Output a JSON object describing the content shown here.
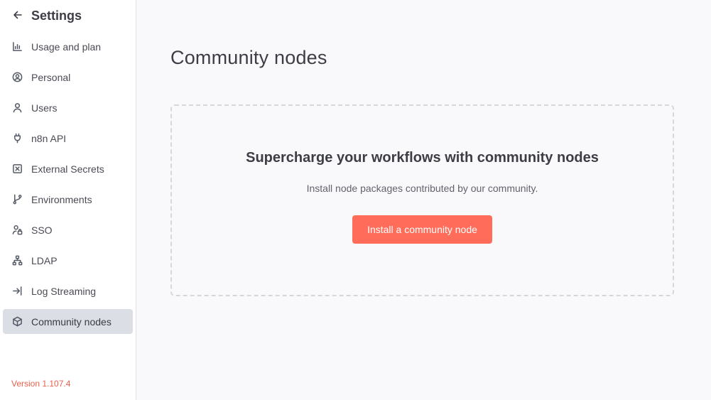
{
  "sidebar": {
    "title": "Settings",
    "items": [
      {
        "label": "Usage and plan",
        "icon": "chart-bar-icon"
      },
      {
        "label": "Personal",
        "icon": "user-circle-icon"
      },
      {
        "label": "Users",
        "icon": "user-icon"
      },
      {
        "label": "n8n API",
        "icon": "plug-icon"
      },
      {
        "label": "External Secrets",
        "icon": "square-x-icon"
      },
      {
        "label": "Environments",
        "icon": "git-branch-icon"
      },
      {
        "label": "SSO",
        "icon": "user-lock-icon"
      },
      {
        "label": "LDAP",
        "icon": "network-icon"
      },
      {
        "label": "Log Streaming",
        "icon": "log-in-icon"
      },
      {
        "label": "Community nodes",
        "icon": "box-icon",
        "active": true
      }
    ],
    "version": "Version 1.107.4"
  },
  "main": {
    "title": "Community nodes",
    "empty_state": {
      "heading": "Supercharge your workflows with community nodes",
      "description": "Install node packages contributed by our community.",
      "button_label": "Install a community node"
    }
  },
  "colors": {
    "accent": "#ff6d5a",
    "version_text": "#ea5f4c",
    "active_item_bg": "#dcdee6"
  }
}
